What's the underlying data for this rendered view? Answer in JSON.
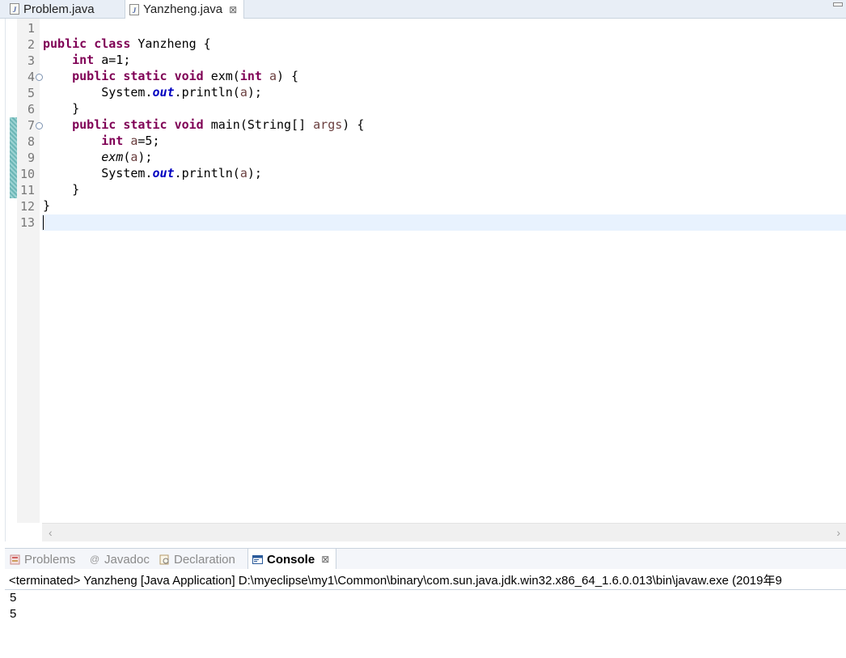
{
  "editor_tabs": [
    {
      "label": "Problem.java",
      "icon": "java-file-icon",
      "active": false
    },
    {
      "label": "Yanzheng.java",
      "icon": "java-file-icon",
      "active": true,
      "close": "⊠"
    }
  ],
  "editor": {
    "line_numbers": [
      "1",
      "2",
      "3",
      "4",
      "5",
      "6",
      "7",
      "8",
      "9",
      "10",
      "11",
      "12",
      "13"
    ],
    "code_lines": [
      "",
      "public class Yanzheng {",
      "    int a=1;",
      "    public static void exm(int a) {",
      "        System.out.println(a);",
      "    }",
      "    public static void main(String[] args) {",
      "        int a=5;",
      "        exm(a);",
      "        System.out.println(a);",
      "    }",
      "}",
      ""
    ],
    "fold_markers": [
      "⊖",
      "⊖"
    ],
    "scroll_left": "‹",
    "scroll_right": "›"
  },
  "panel_tabs": [
    {
      "label": "Problems",
      "icon": "problems-icon",
      "active": false
    },
    {
      "label": "Javadoc",
      "icon": "at-icon",
      "active": false
    },
    {
      "label": "Declaration",
      "icon": "declaration-icon",
      "active": false
    },
    {
      "label": "Console",
      "icon": "console-icon",
      "active": true,
      "close": "⊠"
    }
  ],
  "console": {
    "header": "<terminated> Yanzheng [Java Application] D:\\myeclipse\\my1\\Common\\binary\\com.sun.java.jdk.win32.x86_64_1.6.0.013\\bin\\javaw.exe (2019年9",
    "output": [
      "5",
      "5"
    ]
  },
  "colors": {
    "keyword": "#7f0055",
    "static_field": "#0000c0",
    "local_var": "#6a3e3e",
    "current_line": "#e8f2fe"
  }
}
